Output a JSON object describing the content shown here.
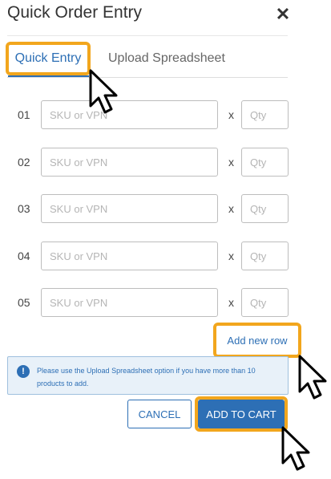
{
  "dialog": {
    "title": "Quick Order Entry",
    "close_icon": "close-icon"
  },
  "tabs": [
    {
      "label": "Quick Entry",
      "active": true
    },
    {
      "label": "Upload Spreadsheet",
      "active": false
    }
  ],
  "rows": [
    {
      "number": "01",
      "sku_placeholder": "SKU or VPN",
      "sku_value": "",
      "times": "x",
      "qty_placeholder": "Qty",
      "qty_value": ""
    },
    {
      "number": "02",
      "sku_placeholder": "SKU or VPN",
      "sku_value": "",
      "times": "x",
      "qty_placeholder": "Qty",
      "qty_value": ""
    },
    {
      "number": "03",
      "sku_placeholder": "SKU or VPN",
      "sku_value": "",
      "times": "x",
      "qty_placeholder": "Qty",
      "qty_value": ""
    },
    {
      "number": "04",
      "sku_placeholder": "SKU or VPN",
      "sku_value": "",
      "times": "x",
      "qty_placeholder": "Qty",
      "qty_value": ""
    },
    {
      "number": "05",
      "sku_placeholder": "SKU or VPN",
      "sku_value": "",
      "times": "x",
      "qty_placeholder": "Qty",
      "qty_value": ""
    }
  ],
  "add_row_label": "Add new row",
  "info": {
    "icon": "info-icon",
    "icon_glyph": "!",
    "text": "Please use the Upload Spreadsheet option if you have more than 10 products to add."
  },
  "buttons": {
    "cancel_label": "CANCEL",
    "add_to_cart_label": "ADD TO CART"
  },
  "colors": {
    "accent": "#2d6fb5",
    "highlight": "#f2a61d",
    "info_bg": "#e8f1f9"
  }
}
